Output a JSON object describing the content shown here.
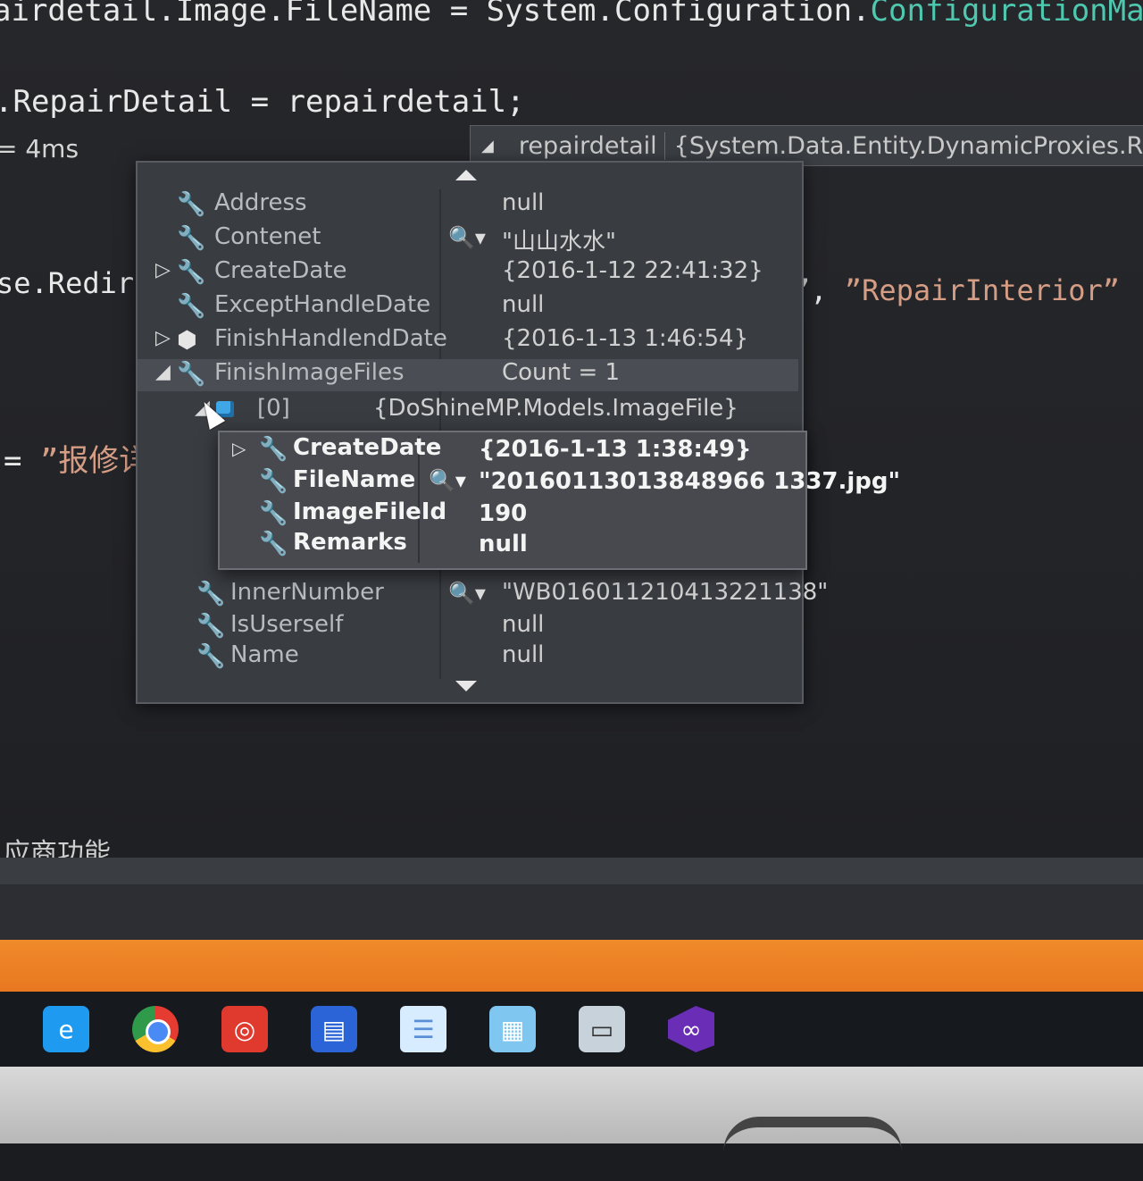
{
  "code": {
    "line1_prefix": "airdetail.Image.FileName = System.Configuration.",
    "line1_class": "ConfigurationMa",
    "line2": ".RepairDetail = repairdetail;",
    "line3": "= 4ms",
    "line4": "se.Redire",
    "line4_right_quote": "”,",
    "line4_right_str": "”RepairInterior”",
    "line5_prefix": "= ",
    "line5_str": "”报修详",
    "line6": "应商功能"
  },
  "tip_header": {
    "name": "repairdetail",
    "value": "{System.Data.Entity.DynamicProxies.Repa"
  },
  "datatip_rows": [
    {
      "expander": "",
      "icon": "wrench-icon",
      "name": "Address",
      "search": false,
      "value": "null"
    },
    {
      "expander": "",
      "icon": "wrench-icon",
      "name": "Contenet",
      "search": true,
      "value": "\"山山水水\""
    },
    {
      "expander": "▷",
      "icon": "wrench-icon",
      "name": "CreateDate",
      "search": false,
      "value": "{2016-1-12 22:41:32}"
    },
    {
      "expander": "",
      "icon": "wrench-icon",
      "name": "ExceptHandleDate",
      "search": false,
      "value": "null"
    },
    {
      "expander": "▷",
      "icon": "object-icon",
      "name": "FinishHandlendDate",
      "search": false,
      "value": "{2016-1-13 1:46:54}"
    },
    {
      "expander": "◢",
      "icon": "wrench-icon",
      "name": "FinishImageFiles",
      "search": false,
      "value": "Count = 1"
    },
    {
      "expander": "◢",
      "icon": "cube-icon",
      "name": "[0]",
      "search": false,
      "value": "{DoShineMP.Models.ImageFile}"
    },
    {
      "expander": "",
      "icon": "wrench-icon",
      "name": "InnerNumber",
      "search": true,
      "value": "\"WB016011210413221138\""
    },
    {
      "expander": "",
      "icon": "wrench-icon",
      "name": "IsUserself",
      "search": false,
      "value": "null"
    },
    {
      "expander": "",
      "icon": "wrench-icon",
      "name": "Name",
      "search": false,
      "value": "null"
    }
  ],
  "popup_rows": [
    {
      "expander": "▷",
      "name": "CreateDate",
      "search": false,
      "value": "{2016-1-13 1:38:49}"
    },
    {
      "expander": "",
      "name": "FileName",
      "search": true,
      "value": "\"20160113013848966 1337.jpg\""
    },
    {
      "expander": "",
      "name": "ImageFileId",
      "search": false,
      "value": "190"
    },
    {
      "expander": "",
      "name": "Remarks",
      "search": false,
      "value": "null"
    }
  ],
  "colors": {
    "accent_orange": "#f08a2a",
    "editor_bg": "#232428",
    "datatip_bg": "#393c41"
  },
  "taskbar_icons": [
    "ie-icon",
    "chrome-icon",
    "netease-music-icon",
    "network-icon",
    "chat-icon",
    "file-icon",
    "remote-desktop-icon",
    "visual-studio-icon"
  ]
}
